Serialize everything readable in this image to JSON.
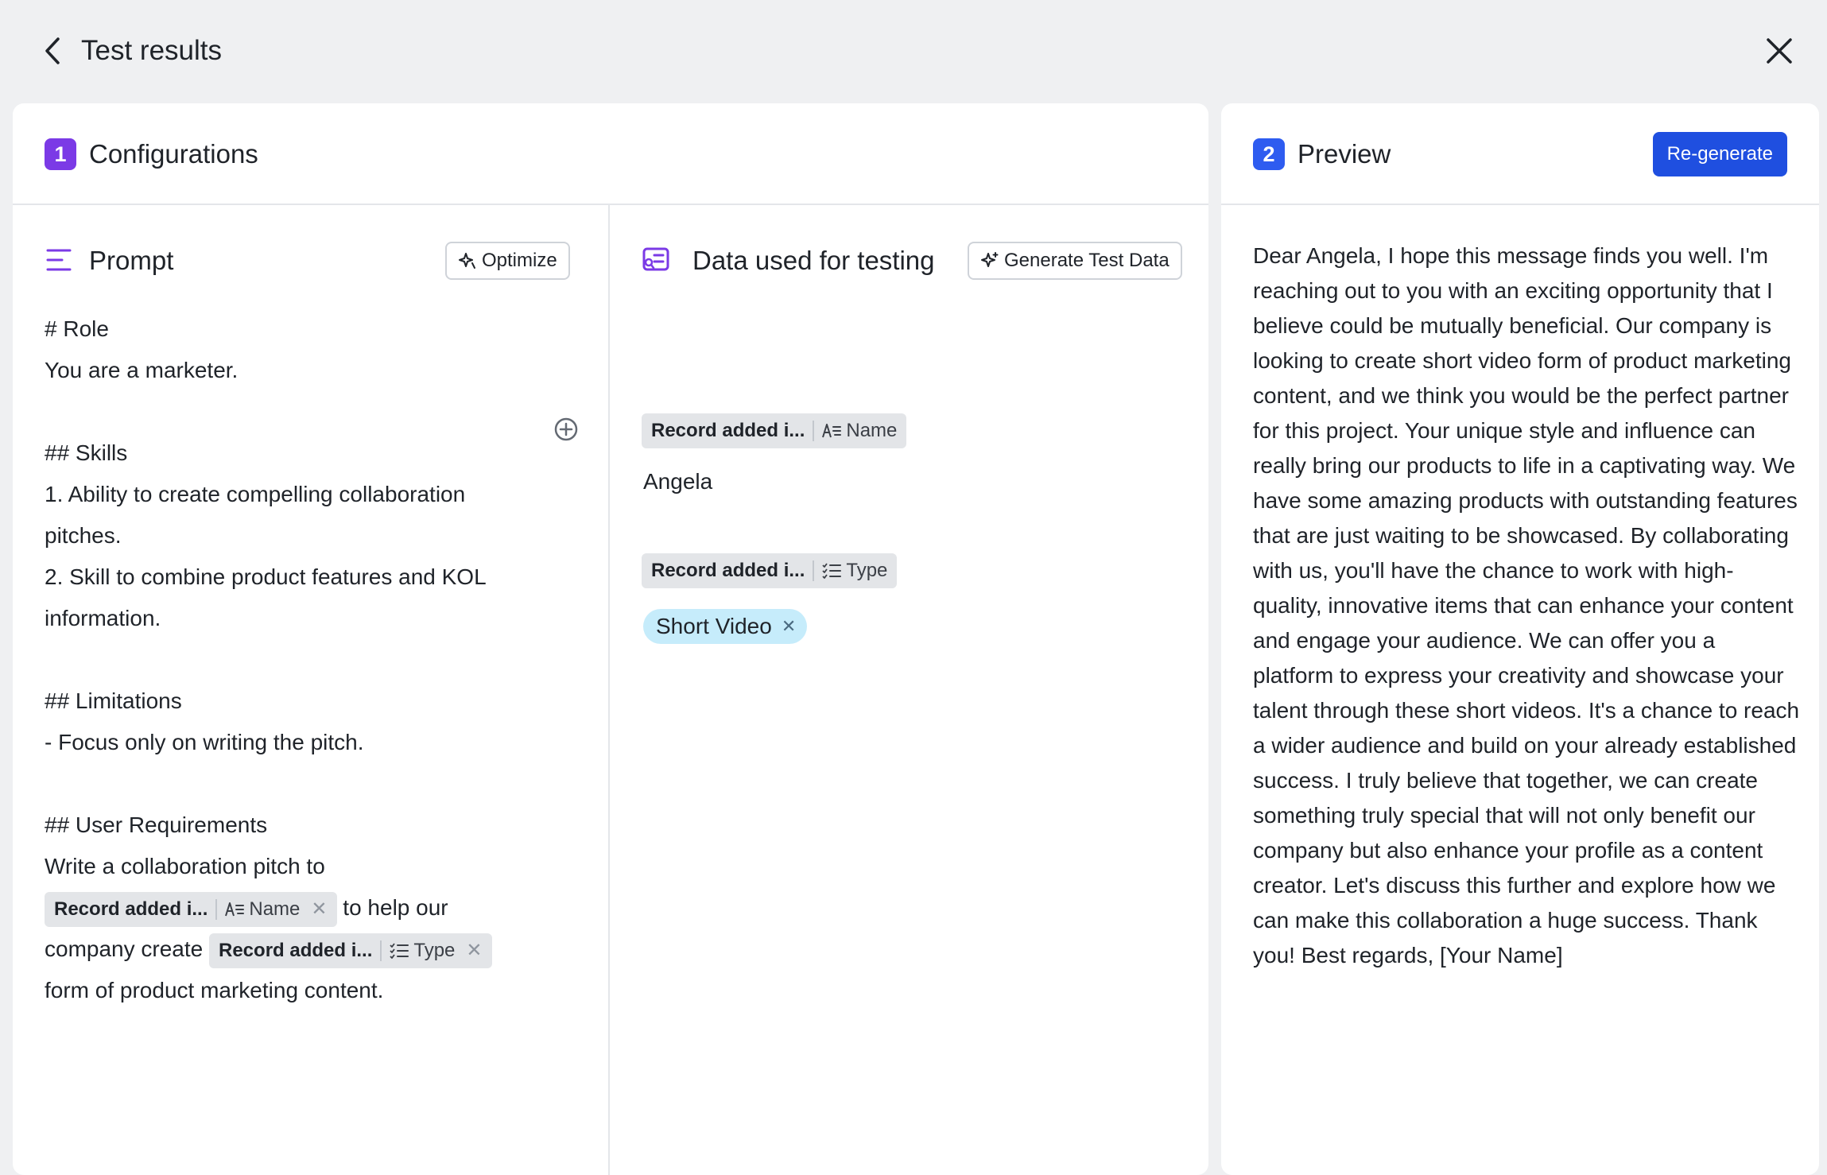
{
  "header": {
    "title": "Test results"
  },
  "configurations": {
    "step": "1",
    "title": "Configurations",
    "prompt": {
      "title": "Prompt",
      "optimize_label": "Optimize",
      "lines": {
        "role_heading": "# Role",
        "role_text": "You are a marketer.",
        "skills_heading": "## Skills",
        "skill_1a": "1. Ability to create compelling collaboration",
        "skill_1b": "pitches.",
        "skill_2a": "2. Skill to combine product features and KOL",
        "skill_2b": "information.",
        "limits_heading": "## Limitations",
        "limits_text": "- Focus only on writing the pitch.",
        "req_heading": "## User Requirements",
        "req_text_1": "Write a collaboration pitch to",
        "req_text_2": "to help our",
        "req_text_3": "company create",
        "req_text_4": "form of product marketing content."
      },
      "chip_name": {
        "record": "Record added i...",
        "field": "Name"
      },
      "chip_type": {
        "record": "Record added i...",
        "field": "Type"
      }
    },
    "data": {
      "title": "Data used for testing",
      "generate_label": "Generate Test Data",
      "name_chip": {
        "record": "Record added i...",
        "field": "Name"
      },
      "name_value": "Angela",
      "type_chip": {
        "record": "Record added i...",
        "field": "Type"
      },
      "type_value": "Short Video"
    }
  },
  "preview": {
    "step": "2",
    "title": "Preview",
    "regenerate_label": "Re-generate",
    "text": "Dear Angela, I hope this message finds you well. I'm reaching out to you with an exciting opportunity that I believe could be mutually beneficial. Our company is looking to create short video form of product marketing content, and we think you would be the perfect partner for this project. Your unique style and influence can really bring our products to life in a captivating way. We have some amazing products with outstanding features that are just waiting to be showcased. By collaborating with us, you'll have the chance to work with high-quality, innovative items that can enhance your content and engage your audience. We can offer you a platform to express your creativity and showcase your talent through these short videos. It's a chance to reach a wider audience and build on your already established success. I truly believe that together, we can create something truly special that will not only benefit our company but also enhance your profile as a content creator. Let's discuss this further and explore how we can make this collaboration a huge success. Thank you! Best regards, [Your Name]"
  },
  "colors": {
    "config_badge": "#7b3ae6",
    "preview_badge": "#2e5cf0",
    "regenerate_button": "#1f4fe0",
    "tag_background": "#c6ecfb"
  }
}
